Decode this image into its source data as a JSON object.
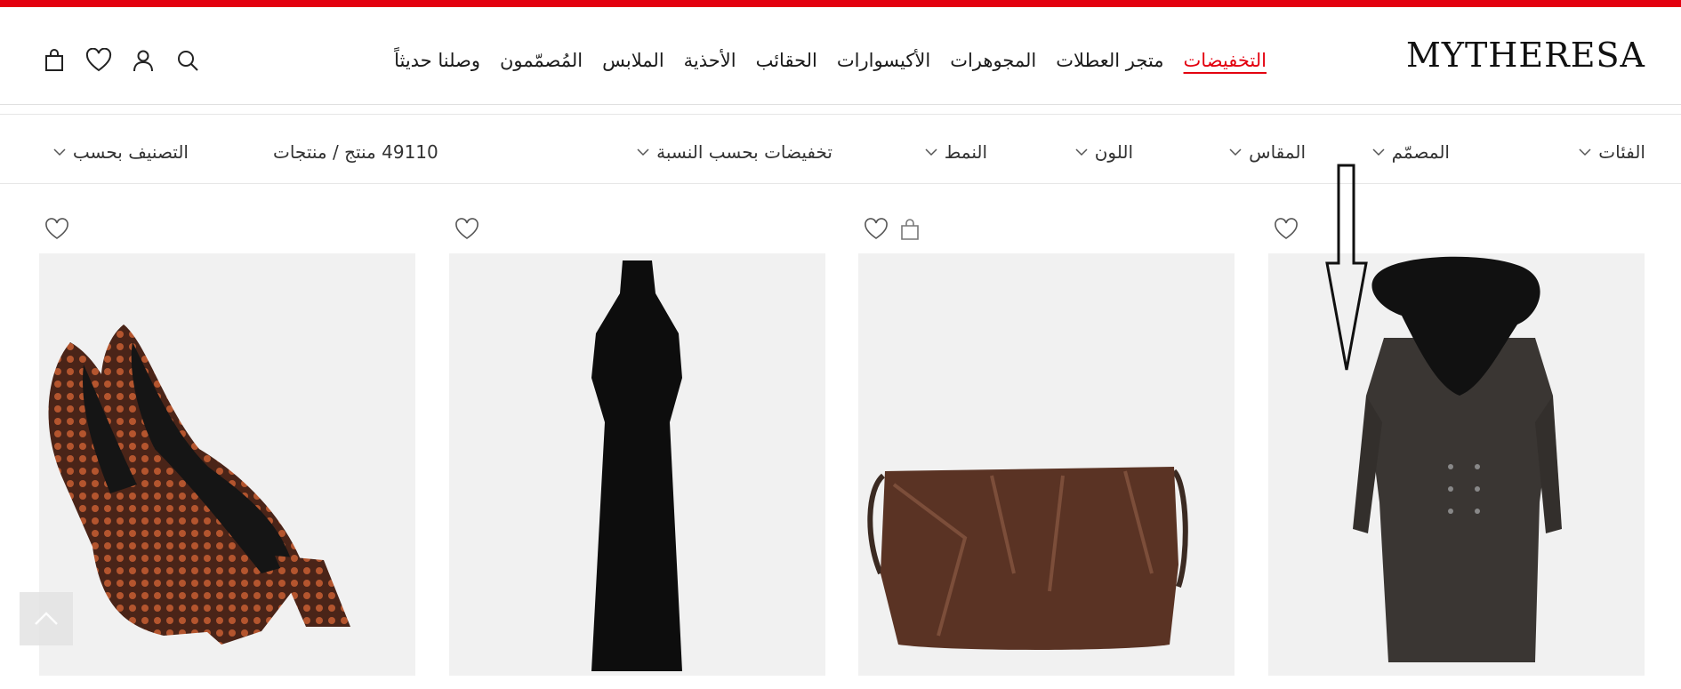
{
  "brand": {
    "logo": "MYTHERESA"
  },
  "colors": {
    "accent": "#e3000f",
    "image_bg": "#f1f1f1"
  },
  "nav": {
    "items": [
      "وصلنا حديثاً",
      "المُصمّمون",
      "الملابس",
      "الأحذية",
      "الحقائب",
      "الأكيسوارات",
      "المجوهرات",
      "متجر العطلات",
      "التخفيضات"
    ]
  },
  "header_icons": [
    "search-icon",
    "account-icon",
    "wishlist-icon",
    "bag-icon"
  ],
  "filters": {
    "categories": "الفئات",
    "designer": "المصمّم",
    "size": "المقاس",
    "color": "اللون",
    "style": "النمط",
    "discount": "تخفيضات بحسب النسبة",
    "count": "49110 منتج / منتجات",
    "sort": "التصنيف بحسب"
  },
  "products": [
    {
      "name": "coat",
      "icons": [
        "heart-icon"
      ]
    },
    {
      "name": "bag",
      "icons": [
        "heart-icon",
        "bag-icon"
      ]
    },
    {
      "name": "dress",
      "icons": [
        "heart-icon"
      ]
    },
    {
      "name": "pumps",
      "icons": [
        "heart-icon"
      ]
    }
  ]
}
